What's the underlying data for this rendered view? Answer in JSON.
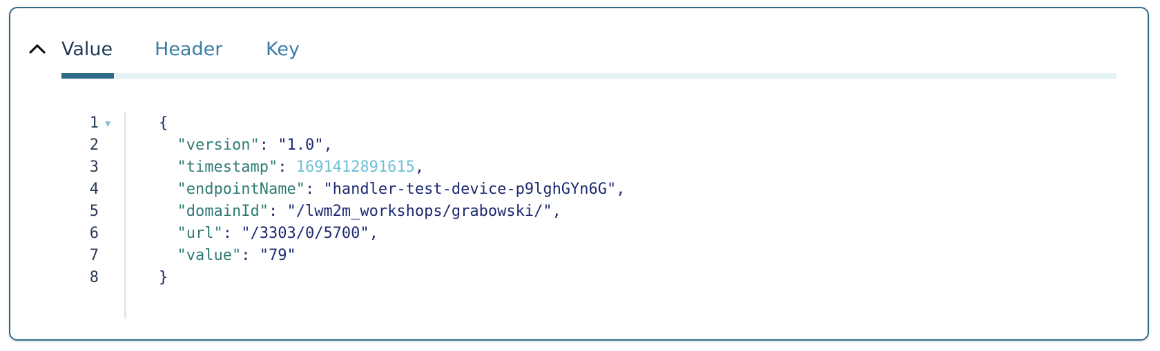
{
  "tabs": [
    {
      "label": "Value",
      "active": true
    },
    {
      "label": "Header",
      "active": false
    },
    {
      "label": "Key",
      "active": false
    }
  ],
  "editor": {
    "line_numbers": [
      "1",
      "2",
      "3",
      "4",
      "5",
      "6",
      "7",
      "8"
    ],
    "open_brace": "{",
    "close_brace": "}",
    "fields": [
      {
        "key": "\"version\"",
        "value": "\"1.0\"",
        "type": "string",
        "trailing": ","
      },
      {
        "key": "\"timestamp\"",
        "value": "1691412891615",
        "type": "number",
        "trailing": ","
      },
      {
        "key": "\"endpointName\"",
        "value": "\"handler-test-device-p9lghGYn6G\"",
        "type": "string",
        "trailing": ","
      },
      {
        "key": "\"domainId\"",
        "value": "\"/lwm2m_workshops/grabowski/\"",
        "type": "string",
        "trailing": ","
      },
      {
        "key": "\"url\"",
        "value": "\"/3303/0/5700\"",
        "type": "string",
        "trailing": ","
      },
      {
        "key": "\"value\"",
        "value": "\"79\"",
        "type": "string",
        "trailing": ""
      }
    ]
  },
  "colors": {
    "accent": "#2f6a88",
    "tab_inactive": "#3a7ca5",
    "json_key": "#2f7a74",
    "json_string": "#1c2a70",
    "json_number": "#6cc0d6"
  },
  "icons": {
    "collapse": "chevron-up-icon",
    "fold": "fold-triangle-icon"
  }
}
